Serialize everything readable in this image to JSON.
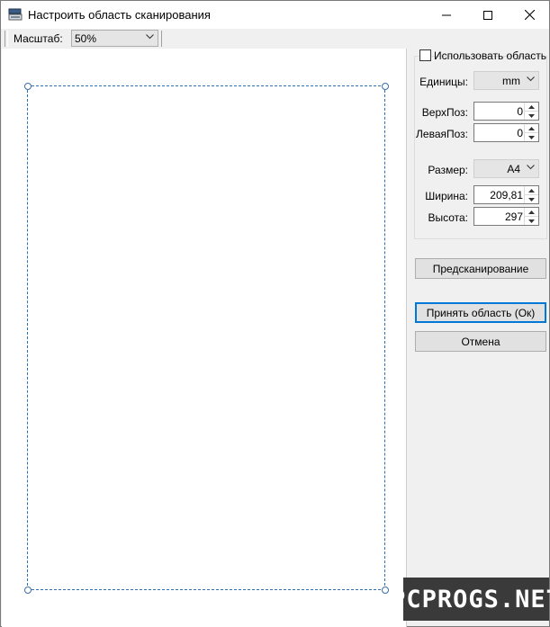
{
  "window": {
    "title": "Настроить область сканирования"
  },
  "toolbar": {
    "zoom_label": "Масштаб:",
    "zoom_value": "50%"
  },
  "panel": {
    "use_area_label": "Использовать область",
    "use_area_checked": false,
    "units_label": "Единицы:",
    "units_value": "mm",
    "top_label": "ВерхПоз:",
    "top_value": "0",
    "left_label": "ЛеваяПоз:",
    "left_value": "0",
    "size_label": "Размер:",
    "size_value": "A4",
    "width_label": "Ширина:",
    "width_value": "209,81",
    "height_label": "Высота:",
    "height_value": "297",
    "prescan_button": "Предсканирование",
    "accept_button": "Принять область (Ок)",
    "cancel_button": "Отмена"
  },
  "watermark": "PCPROGS.NET",
  "colors": {
    "selection": "#2d6fb0",
    "focus": "#0078d7"
  }
}
